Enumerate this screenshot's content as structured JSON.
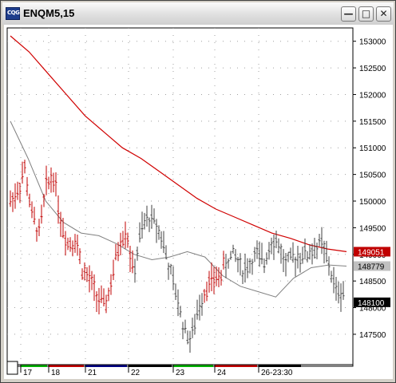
{
  "window": {
    "title": "ENQM5,15",
    "icon": "chart-app-icon",
    "icon_text": "CQG"
  },
  "buttons": [
    {
      "name": "minimize",
      "glyph": "—",
      "icon": "minimize-icon"
    },
    {
      "name": "maximize",
      "glyph": "□",
      "icon": "maximize-icon"
    },
    {
      "name": "close",
      "glyph": "✕",
      "icon": "close-icon"
    }
  ],
  "chart_data": {
    "type": "bar",
    "price_axis": {
      "ticks": [
        "153000",
        "152500",
        "152000",
        "151500",
        "151000",
        "150500",
        "150000",
        "149500",
        "149000",
        "148500",
        "148000",
        "147500"
      ],
      "min": 14690,
      "max": 15325
    },
    "price_labels": [
      {
        "text": "149051",
        "value": 14905,
        "color": "#c00000"
      },
      {
        "text": "148779",
        "value": 14878,
        "color": "#808080"
      },
      {
        "text": "148100",
        "value": 14810,
        "color": "#000000"
      }
    ],
    "time_axis": {
      "labels": [
        "17",
        "18",
        "21",
        "22",
        "23",
        "24",
        "26-23:30"
      ],
      "day_colors": [
        "#00b000",
        "#c00000",
        "#000080",
        "#000000",
        "#00b000",
        "#c00000",
        "#000000"
      ]
    },
    "colors": {
      "down_bars": "#c00000",
      "up_bars": "#404040",
      "ma_long": "#d00000",
      "ma_short": "#808080",
      "grid": "#a0a0a0"
    },
    "ma_long": [
      15310,
      15280,
      15240,
      15200,
      15160,
      15130,
      15100,
      15080,
      15055,
      15030,
      15005,
      14985,
      14970,
      14955,
      14940,
      14930,
      14918,
      14910,
      14905
    ],
    "ma_short": [
      15150,
      15080,
      15000,
      14960,
      14940,
      14935,
      14920,
      14900,
      14890,
      14895,
      14905,
      14895,
      14860,
      14840,
      14830,
      14820,
      14855,
      14875,
      14880,
      14878
    ],
    "price_path": [
      15000,
      15020,
      15060,
      14970,
      14940,
      15030,
      15050,
      14960,
      14920,
      14930,
      14870,
      14850,
      14820,
      14800,
      14850,
      14920,
      14950,
      14860,
      14940,
      14970,
      14960,
      14930,
      14870,
      14820,
      14760,
      14740,
      14800,
      14840,
      14850,
      14860,
      14890,
      14900,
      14870,
      14880,
      14900,
      14880,
      14930,
      14920,
      14880,
      14890,
      14900,
      14900,
      14910,
      14920,
      14880,
      14830,
      14830
    ]
  }
}
